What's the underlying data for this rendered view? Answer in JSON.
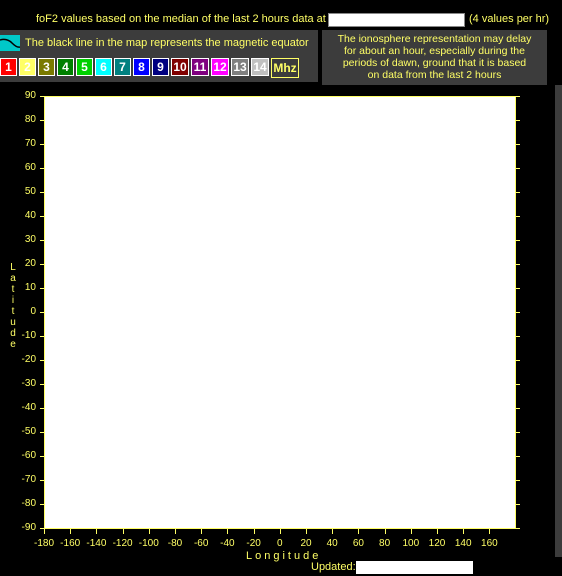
{
  "header": {
    "title": "foF2 values based on the median of the last 2 hours data at",
    "timestamp_value": "",
    "rate": "(4 values per hr)"
  },
  "legend": {
    "equator_text": "The black line in the map represents the magnetic equator",
    "unit": "Mhz",
    "scale": [
      {
        "label": "1",
        "bg": "#ff0000",
        "fg": "#ffffff"
      },
      {
        "label": "2",
        "bg": "#ffff66",
        "fg": "#ffffff"
      },
      {
        "label": "3",
        "bg": "#7a7a00",
        "fg": "#ffffff"
      },
      {
        "label": "4",
        "bg": "#008000",
        "fg": "#ffffff"
      },
      {
        "label": "5",
        "bg": "#00d000",
        "fg": "#ffffff"
      },
      {
        "label": "6",
        "bg": "#00ffff",
        "fg": "#ffffff"
      },
      {
        "label": "7",
        "bg": "#008080",
        "fg": "#ffffff"
      },
      {
        "label": "8",
        "bg": "#0000ff",
        "fg": "#ffffff"
      },
      {
        "label": "9",
        "bg": "#000080",
        "fg": "#ffffff"
      },
      {
        "label": "10",
        "bg": "#800000",
        "fg": "#ffffff"
      },
      {
        "label": "11",
        "bg": "#800080",
        "fg": "#ffffff"
      },
      {
        "label": "12",
        "bg": "#ff00ff",
        "fg": "#ffffff"
      },
      {
        "label": "13",
        "bg": "#808080",
        "fg": "#ffffff"
      },
      {
        "label": "14",
        "bg": "#c0c0c0",
        "fg": "#ffffff"
      }
    ]
  },
  "note": {
    "lines": [
      "The ionosphere representation may delay",
      "for about an hour, especially during the",
      "periods of dawn, ground that it is based",
      "on data from the last 2 hours"
    ]
  },
  "map": {
    "y_axis_title": "Latitude",
    "x_axis_title": "Longitude",
    "y_ticks": [
      "90",
      "80",
      "70",
      "60",
      "50",
      "40",
      "30",
      "20",
      "10",
      "0",
      "-10",
      "-20",
      "-30",
      "-40",
      "-50",
      "-60",
      "-70",
      "-80",
      "-90"
    ],
    "x_ticks": [
      "-180",
      "-160",
      "-140",
      "-120",
      "-100",
      "-80",
      "-60",
      "-40",
      "-20",
      "0",
      "20",
      "40",
      "60",
      "80",
      "100",
      "120",
      "140",
      "160"
    ]
  },
  "footer": {
    "updated_label": "Updated:",
    "updated_value": ""
  }
}
